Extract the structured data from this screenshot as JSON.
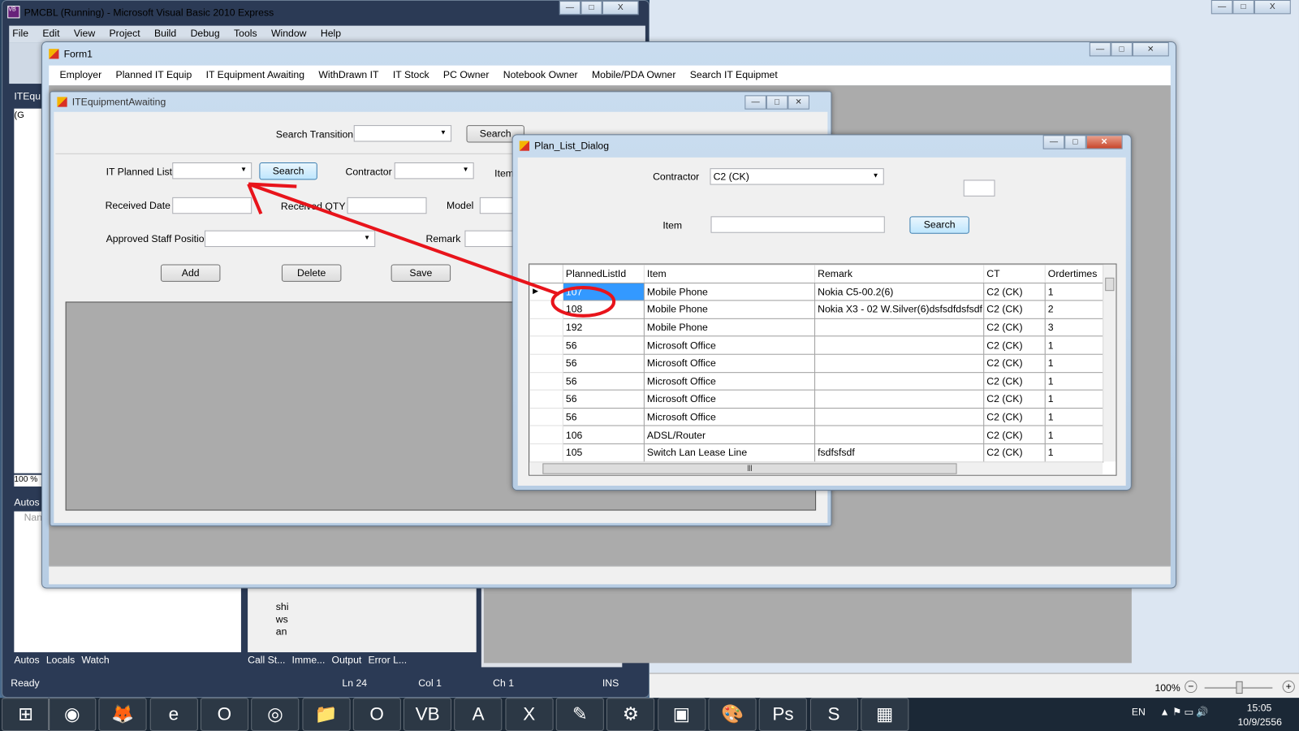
{
  "vs": {
    "title": "PMCBL (Running) - Microsoft Visual Basic 2010 Express",
    "menu": [
      "File",
      "Edit",
      "View",
      "Project",
      "Build",
      "Debug",
      "Tools",
      "Window",
      "Help"
    ],
    "side_tab": "ITEqu",
    "side_item": "(G",
    "zoom": "100 %",
    "autos_header": "Autos",
    "name_col": "Nan",
    "output_lines": [
      "shi",
      "ws",
      "an"
    ],
    "bottom_tabs_left": [
      "Autos",
      "Locals",
      "Watch"
    ],
    "bottom_tabs_right": [
      "Call St...",
      "Imme...",
      "Output",
      "Error L..."
    ],
    "status": {
      "ready": "Ready",
      "ln": "Ln 24",
      "col": "Col 1",
      "ch": "Ch 1",
      "ins": "INS"
    },
    "zoom_pct": "100%"
  },
  "form1": {
    "title": "Form1",
    "menu": [
      "Employer",
      "Planned IT Equip",
      "IT Equipment Awaiting",
      "WithDrawn IT",
      "IT Stock",
      "PC Owner",
      "Notebook Owner",
      "Mobile/PDA Owner",
      "Search IT Equipmet"
    ]
  },
  "awaiting": {
    "title": "ITEquipmentAwaiting",
    "search_transition_label": "Search Transition",
    "search_btn": "Search",
    "planned_list_label": "IT Planned List",
    "planned_search_btn": "Search",
    "contractor_label": "Contractor",
    "item_label": "Item",
    "received_date_label": "Received Date",
    "received_qty_label": "Received QTY",
    "model_label": "Model",
    "approved_label": "Approved Staff Position",
    "remark_label": "Remark",
    "add_btn": "Add",
    "delete_btn": "Delete",
    "save_btn": "Save"
  },
  "dialog": {
    "title": "Plan_List_Dialog",
    "contractor_label": "Contractor",
    "contractor_value": "C2 (CK)",
    "item_label": "Item",
    "item_value": "",
    "search_btn": "Search",
    "columns": [
      "PlannedListId",
      "Item",
      "Remark",
      "CT",
      "Ordertimes"
    ],
    "rows": [
      [
        "107",
        "Mobile Phone",
        "Nokia C5-00.2(6)",
        "C2 (CK)",
        "1"
      ],
      [
        "108",
        "Mobile Phone",
        "Nokia X3 - 02 W.Silver(6)dsfsdfdsfsdf",
        "C2 (CK)",
        "2"
      ],
      [
        "192",
        "Mobile Phone",
        "",
        "C2 (CK)",
        "3"
      ],
      [
        "56",
        "Microsoft Office",
        "",
        "C2 (CK)",
        "1"
      ],
      [
        "56",
        "Microsoft Office",
        "",
        "C2 (CK)",
        "1"
      ],
      [
        "56",
        "Microsoft Office",
        "",
        "C2 (CK)",
        "1"
      ],
      [
        "56",
        "Microsoft Office",
        "",
        "C2 (CK)",
        "1"
      ],
      [
        "56",
        "Microsoft Office",
        "",
        "C2 (CK)",
        "1"
      ],
      [
        "106",
        "ADSL/Router",
        "",
        "C2 (CK)",
        "1"
      ],
      [
        "105",
        "Switch Lan Lease Line",
        "fsdfsfsdf",
        "C2 (CK)",
        "1"
      ]
    ],
    "selected_row": 0
  },
  "taskbar": {
    "apps": [
      "windows-start",
      "chrome",
      "firefox",
      "internet-explorer",
      "opera",
      "safari",
      "file-explorer",
      "outlook",
      "visual-basic",
      "access",
      "excel",
      "notepad",
      "settings",
      "terminal",
      "paint",
      "photoshop",
      "skype",
      "windows-app"
    ],
    "lang": "EN",
    "time": "15:05",
    "date": "10/9/2556"
  },
  "colors": {
    "selection": "#3399ff",
    "annotation": "#e8141b",
    "taskbar": "#1b2836"
  }
}
